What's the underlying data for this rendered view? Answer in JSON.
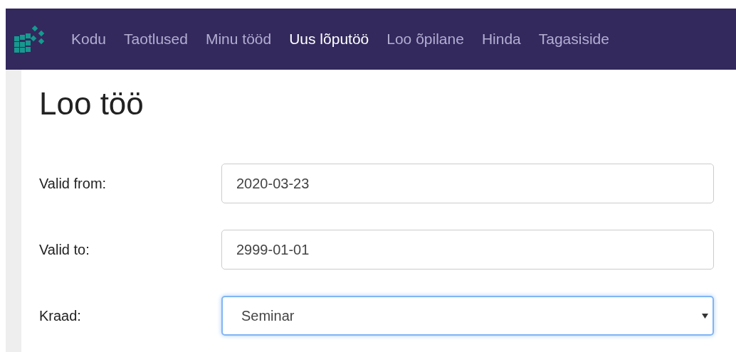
{
  "nav": {
    "items": [
      {
        "label": "Kodu",
        "selected": false
      },
      {
        "label": "Taotlused",
        "selected": false
      },
      {
        "label": "Minu tööd",
        "selected": false
      },
      {
        "label": "Uus lõputöö",
        "selected": true
      },
      {
        "label": "Loo õpilane",
        "selected": false
      },
      {
        "label": "Hinda",
        "selected": false
      },
      {
        "label": "Tagasiside",
        "selected": false
      }
    ]
  },
  "page_title": "Loo töö",
  "form": {
    "fields": [
      {
        "label": "Valid from:",
        "kind": "input",
        "value": "2020-03-23",
        "focused": false
      },
      {
        "label": "Valid to:",
        "kind": "input",
        "value": "2999-01-01",
        "focused": false
      },
      {
        "label": "Kraad:",
        "kind": "select",
        "value": "Seminar",
        "focused": true
      }
    ]
  }
}
